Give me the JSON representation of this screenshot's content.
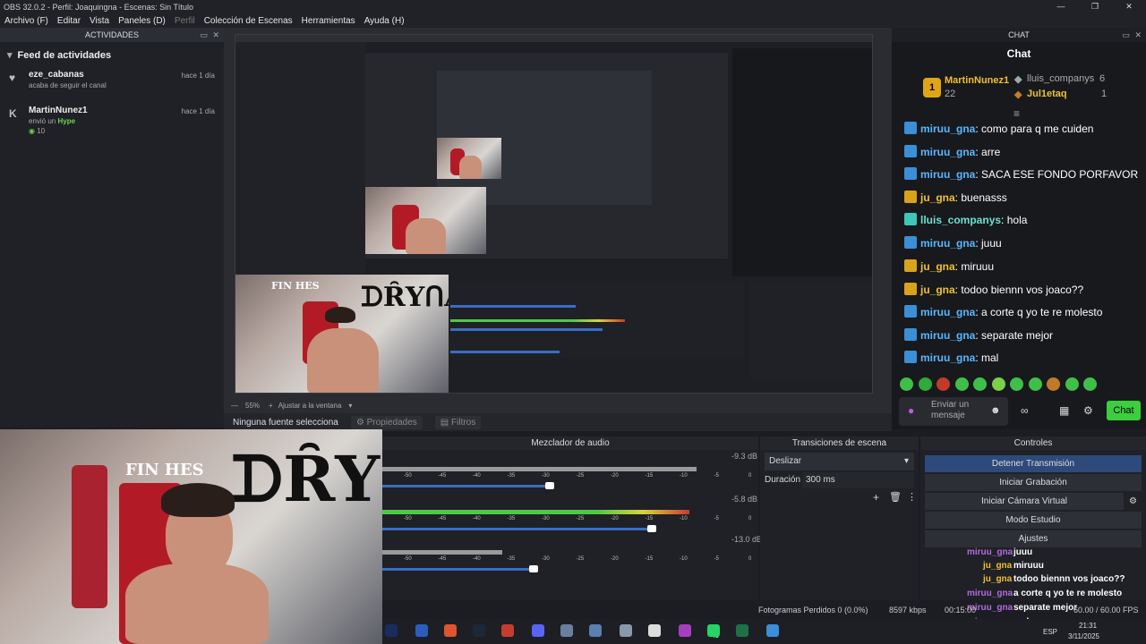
{
  "titlebar": {
    "title": "OBS 32.0.2 - Perfil: Joaquingna - Escenas: Sin Título",
    "minimize": "—",
    "maximize": "❐",
    "close": "✕"
  },
  "menu": {
    "items": [
      "Archivo (F)",
      "Editar",
      "Vista",
      "Paneles (D)"
    ],
    "disabled": "Perfil",
    "items2": [
      "Colección de Escenas",
      "Herramientas",
      "Ayuda (H)"
    ]
  },
  "activities": {
    "title": "ACTIVIDADES",
    "feed_title": "Feed de actividades",
    "items": [
      {
        "icon": "heart-icon",
        "name": "eze_cabanas",
        "sub": "acaba de seguir el canal",
        "time": "hace 1 día"
      },
      {
        "icon": "kick-icon",
        "name": "MartinNunez1",
        "sub_prefix": "envió un",
        "hype": "Hype",
        "amount": "10",
        "time": "hace 1 día"
      }
    ]
  },
  "preview": {
    "zoom": "55%",
    "fit": "Ajustar a la ventana"
  },
  "source_bar": {
    "label": "Ninguna fuente selecciona",
    "properties": "Propiedades",
    "filters": "Filtros"
  },
  "chat": {
    "dock_title": "CHAT",
    "title": "Chat",
    "leaders": [
      {
        "name": "MartinNunez1",
        "value": "22"
      },
      {
        "name": "lluis_companys",
        "value": "6"
      },
      {
        "name": "Jul1etaq",
        "value": "1"
      }
    ],
    "messages": [
      {
        "user": "miruu_gna",
        "color": "blue",
        "text": "como para q me cuiden"
      },
      {
        "user": "miruu_gna",
        "color": "blue",
        "text": "arre"
      },
      {
        "user": "miruu_gna",
        "color": "blue",
        "text": "SACA ESE FONDO PORFAVOR"
      },
      {
        "user": "ju_gna",
        "color": "gold",
        "text": "buenasss"
      },
      {
        "user": "lluis_companys",
        "color": "teal",
        "text": "hola"
      },
      {
        "user": "miruu_gna",
        "color": "blue",
        "text": "juuu"
      },
      {
        "user": "ju_gna",
        "color": "gold",
        "text": "miruuu"
      },
      {
        "user": "ju_gna",
        "color": "gold",
        "text": "todoo biennn vos joaco??"
      },
      {
        "user": "miruu_gna",
        "color": "blue",
        "text": "a corte q yo te re molesto"
      },
      {
        "user": "miruu_gna",
        "color": "blue",
        "text": "separate mejor"
      },
      {
        "user": "miruu_gna",
        "color": "blue",
        "text": "mal"
      }
    ],
    "input_placeholder": "Enviar un mensaje",
    "send": "Chat"
  },
  "mixer": {
    "title": "Mezclador de audio",
    "channels": [
      {
        "db": "-9.3 dB",
        "level": 0.62
      },
      {
        "db": "-5.8 dB",
        "level": 1.0
      },
      {
        "db": "-13.0 dB",
        "level": 0.56
      }
    ],
    "ticks": [
      "-50",
      "-45",
      "-40",
      "-35",
      "-30",
      "-25",
      "-20",
      "-15",
      "-10",
      "-5",
      "0"
    ]
  },
  "transitions": {
    "title": "Transiciones de escena",
    "selected": "Deslizar",
    "duration_label": "Duración",
    "duration": "300 ms"
  },
  "controls": {
    "title": "Controles",
    "buttons": [
      "Detener Transmisión",
      "Iniciar Grabación",
      "Iniciar Cámara Virtual",
      "Modo Estudio",
      "Ajustes"
    ]
  },
  "overlay_chat": [
    {
      "user": "miruu_gna",
      "text": "juuu"
    },
    {
      "user": "ju_gna",
      "text": "miruuu"
    },
    {
      "user": "ju_gna",
      "text": "todoo biennn vos joaco??"
    },
    {
      "user": "miruu_gna",
      "text": "a corte q yo te re molesto"
    },
    {
      "user": "miruu_gna",
      "text": "separate mejor"
    },
    {
      "user": "miruu_gna",
      "text": "mal"
    }
  ],
  "status": {
    "dropped": "Fotogramas Perdidos 0 (0.0%)",
    "kbps": "8597 kbps",
    "time": "00:15:00",
    "fps": "60.00 / 60.00 FPS"
  },
  "taskbar": {
    "clock": "21:31",
    "date": "3/11/2025",
    "lang": "ESP",
    "badge": "45"
  }
}
